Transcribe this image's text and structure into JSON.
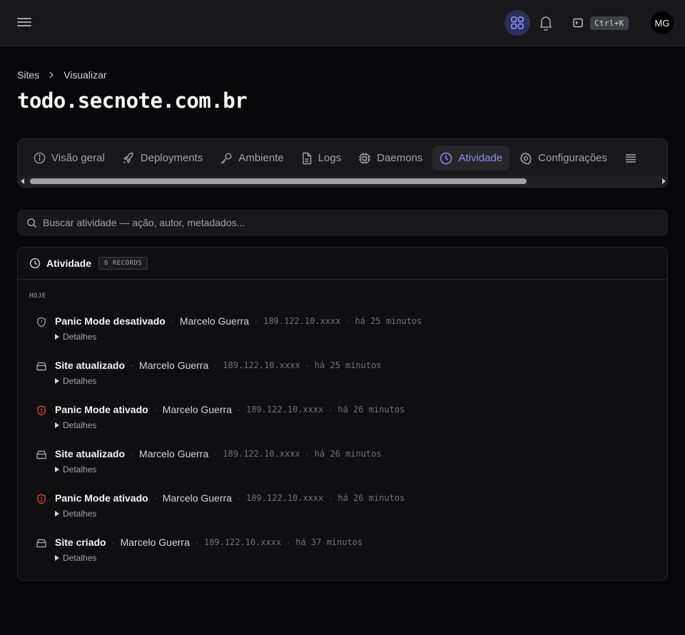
{
  "topbar": {
    "menu_icon": "hamburger-icon",
    "apps_icon": "grid-icon",
    "bell_icon": "bell-icon",
    "terminal_icon": "terminal-icon",
    "shortcut": "Ctrl+K",
    "avatar_initials": "MG",
    "accent": "#8b8ef0"
  },
  "breadcrumb": {
    "root": "Sites",
    "current": "Visualizar"
  },
  "page": {
    "title": "todo.secnote.com.br"
  },
  "tabs": [
    {
      "label": "Visão geral",
      "icon": "info-icon",
      "active": false
    },
    {
      "label": "Deployments",
      "icon": "rocket-icon",
      "active": false
    },
    {
      "label": "Ambiente",
      "icon": "key-icon",
      "active": false
    },
    {
      "label": "Logs",
      "icon": "file-icon",
      "active": false
    },
    {
      "label": "Daemons",
      "icon": "cpu-icon",
      "active": false
    },
    {
      "label": "Atividade",
      "icon": "clock-icon",
      "active": true
    },
    {
      "label": "Configurações",
      "icon": "gear-icon",
      "active": false
    }
  ],
  "search": {
    "placeholder": "Buscar atividade — ação, autor, metadados..."
  },
  "activity": {
    "title": "Atividade",
    "badge": "6 RECORDS",
    "group": "HOJE",
    "details_label": "Detalhes",
    "entries": [
      {
        "action": "Panic Mode desativado",
        "author": "Marcelo Guerra",
        "ip": "189.122.10.xxxx",
        "time": "há 25 minutos",
        "icon": "shield-icon",
        "icon_color": "#a1a1aa"
      },
      {
        "action": "Site atualizado",
        "author": "Marcelo Guerra",
        "ip": "189.122.10.xxxx",
        "time": "há 25 minutos",
        "icon": "server-icon",
        "icon_color": "#a1a1aa"
      },
      {
        "action": "Panic Mode ativado",
        "author": "Marcelo Guerra",
        "ip": "189.122.10.xxxx",
        "time": "há 26 minutos",
        "icon": "shield-alert-icon",
        "icon_color": "#ef4444"
      },
      {
        "action": "Site atualizado",
        "author": "Marcelo Guerra",
        "ip": "189.122.10.xxxx",
        "time": "há 26 minutos",
        "icon": "server-icon",
        "icon_color": "#a1a1aa"
      },
      {
        "action": "Panic Mode ativado",
        "author": "Marcelo Guerra",
        "ip": "189.122.10.xxxx",
        "time": "há 26 minutos",
        "icon": "shield-alert-icon",
        "icon_color": "#ef4444"
      },
      {
        "action": "Site criado",
        "author": "Marcelo Guerra",
        "ip": "189.122.10.xxxx",
        "time": "há 37 minutos",
        "icon": "server-icon",
        "icon_color": "#a1a1aa"
      }
    ]
  }
}
